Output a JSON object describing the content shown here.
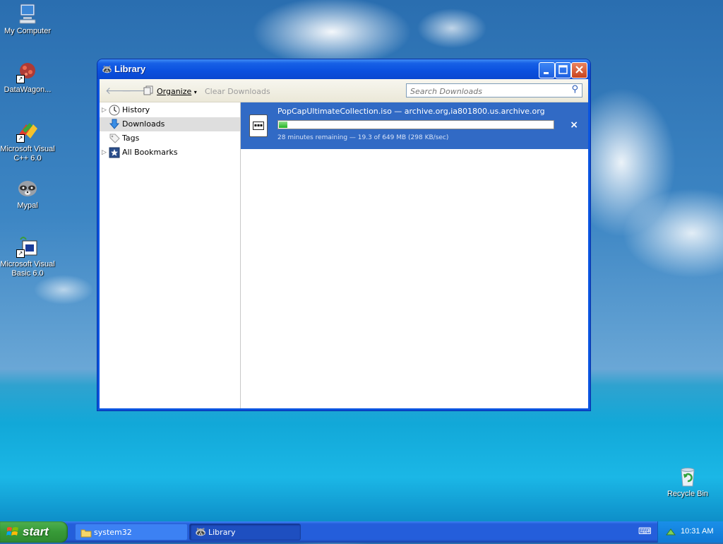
{
  "desktop": {
    "icons": [
      {
        "label": "My Computer",
        "icon": "computer-icon"
      },
      {
        "label": "DataWagon...",
        "icon": "datawagon-icon"
      },
      {
        "label": "Microsoft Visual C++ 6.0",
        "icon": "visual-cpp-icon"
      },
      {
        "label": "Mypal",
        "icon": "mypal-raccoon-icon"
      },
      {
        "label": "Microsoft Visual Basic 6.0",
        "icon": "visual-basic-icon"
      },
      {
        "label": "Recycle Bin",
        "icon": "recycle-bin-icon"
      }
    ]
  },
  "window": {
    "title": "Library",
    "toolbar": {
      "back": "back-arrow-icon",
      "forward": "forward-arrow-icon",
      "organize_label": "Organize",
      "clear_label": "Clear Downloads",
      "search_placeholder": "Search Downloads"
    },
    "sidebar": {
      "items": [
        {
          "label": "History",
          "icon": "clock-icon",
          "expandable": true,
          "selected": false
        },
        {
          "label": "Downloads",
          "icon": "download-arrow-icon",
          "expandable": false,
          "selected": true
        },
        {
          "label": "Tags",
          "icon": "tag-icon",
          "expandable": false,
          "selected": false
        },
        {
          "label": "All Bookmarks",
          "icon": "bookmark-star-icon",
          "expandable": true,
          "selected": false
        }
      ]
    },
    "download": {
      "name": "PopCapUltimateCollection.iso — archive.org,ia801800.us.archive.org",
      "status": "28 minutes remaining — 19.3 of 649 MB (298 KB/sec)",
      "progress_fraction": 0.03,
      "cancel": "×"
    }
  },
  "taskbar": {
    "start_label": "start",
    "tasks": [
      {
        "label": "system32",
        "icon": "folder-icon"
      },
      {
        "label": "Library",
        "icon": "mypal-raccoon-icon"
      }
    ],
    "clock": "10:31 AM"
  },
  "colors": {
    "selection": "#316ac5",
    "progress_fill": "#22b322",
    "titlebar": "#0a50de",
    "start_green": "#379a37"
  }
}
